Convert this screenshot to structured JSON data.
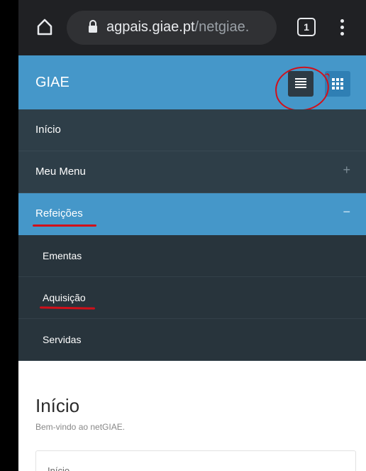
{
  "browser": {
    "url_domain": "agpais.giae.pt",
    "url_path": "/netgiae.",
    "tab_count": "1",
    "icons": {
      "home": "home-icon",
      "lock": "lock-icon",
      "tabs": "tab-switcher-icon",
      "menu": "kebab-menu-icon"
    }
  },
  "app": {
    "title": "GIAE",
    "view_buttons": [
      "list-view-icon",
      "grid-view-icon"
    ],
    "colors": {
      "header": "#4597c9",
      "nav": "#2e3e48",
      "subnav": "#28343c",
      "annotation": "#d1101a"
    }
  },
  "nav": {
    "items": [
      {
        "label": "Início",
        "sign": ""
      },
      {
        "label": "Meu Menu",
        "sign": "+"
      },
      {
        "label": "Refeições",
        "sign": "−",
        "active": true
      }
    ],
    "subitems": [
      {
        "label": "Ementas"
      },
      {
        "label": "Aquisição"
      },
      {
        "label": "Servidas"
      }
    ]
  },
  "content": {
    "title": "Início",
    "subtitle": "Bem-vindo ao netGIAE.",
    "panel_title": "Início"
  }
}
